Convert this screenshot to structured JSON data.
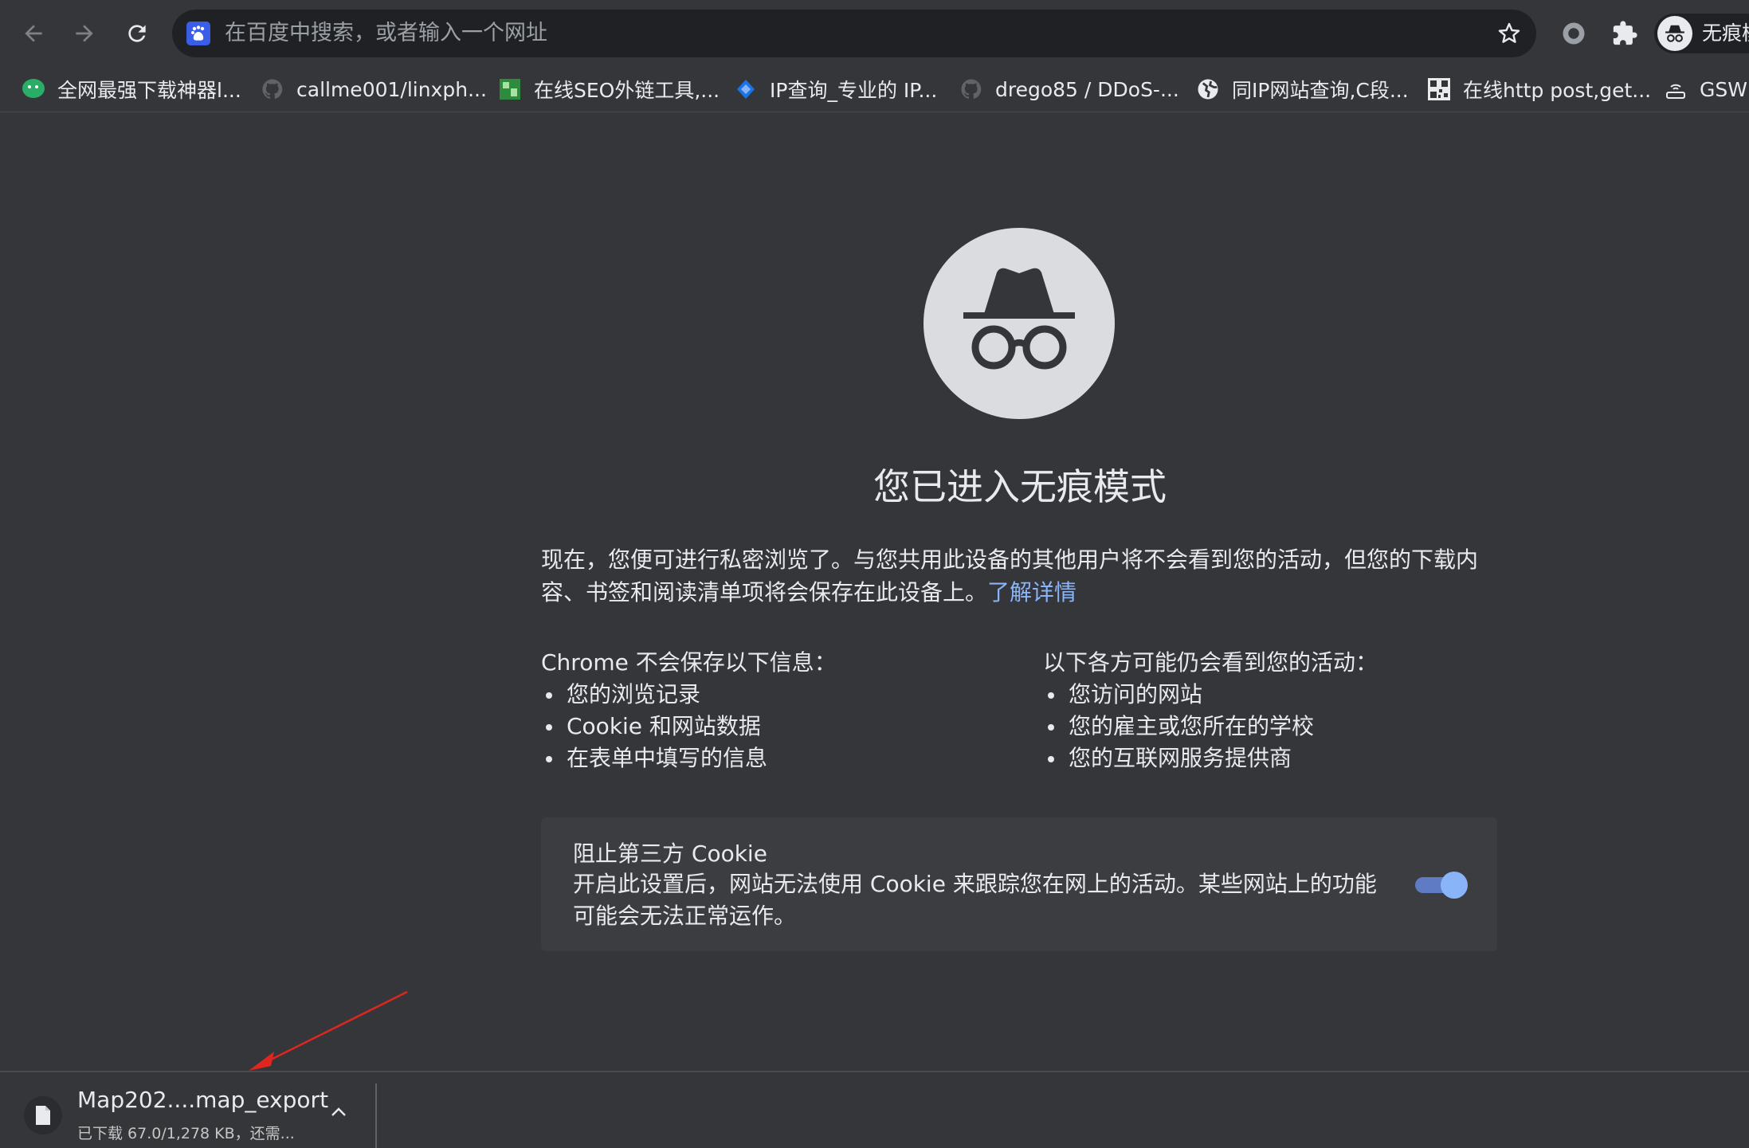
{
  "omnibox": {
    "placeholder": "在百度中搜索，或者输入一个网址"
  },
  "profile": {
    "label": "无痕模式"
  },
  "bookmarks": [
    {
      "label": "全网最强下载神器l...",
      "icon": "wechat-icon"
    },
    {
      "label": "callme001/linxph...",
      "icon": "github-icon"
    },
    {
      "label": "在线SEO外链工具,...",
      "icon": "seo-tool-icon"
    },
    {
      "label": "IP查询_专业的 IP...",
      "icon": "ip-query-icon"
    },
    {
      "label": "drego85 / DDoS-...",
      "icon": "github-icon"
    },
    {
      "label": "同IP网站查询,C段...",
      "icon": "globe-icon"
    },
    {
      "label": "在线http post,get...",
      "icon": "qr-icon"
    },
    {
      "label": "GSWI",
      "icon": "router-icon"
    }
  ],
  "incognito": {
    "title": "您已进入无痕模式",
    "description": "现在，您便可进行私密浏览了。与您共用此设备的其他用户将不会看到您的活动，但您的下载内容、书签和阅读清单项将会保存在此设备上。",
    "learn_more": "了解详情",
    "not_saved_title": "Chrome 不会保存以下信息：",
    "not_saved_items": [
      "您的浏览记录",
      "Cookie 和网站数据",
      "在表单中填写的信息"
    ],
    "visible_title": "以下各方可能仍会看到您的活动：",
    "visible_items": [
      "您访问的网站",
      "您的雇主或您所在的学校",
      "您的互联网服务提供商"
    ],
    "cookie_title": "阻止第三方 Cookie",
    "cookie_desc": "开启此设置后，网站无法使用 Cookie 来跟踪您在网上的活动。某些网站上的功能可能会无法正常运作。",
    "cookie_toggle_on": true
  },
  "download": {
    "filename": "Map202....map_export",
    "status": "已下载 67.0/1,278 KB，还需..."
  },
  "colors": {
    "background": "#35363a",
    "link": "#8ab4f8",
    "toggle": "#8ab4f8",
    "annotation_arrow": "#e0261f"
  }
}
